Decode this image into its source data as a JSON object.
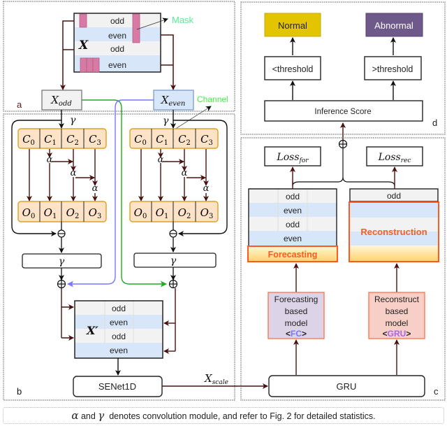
{
  "panels": {
    "a": {
      "label": "a",
      "input": {
        "symbol": "X",
        "rows": [
          "odd",
          "even",
          "odd",
          "even"
        ],
        "mask_label": "Mask"
      },
      "x_odd": "X",
      "x_odd_sub": "odd",
      "x_even": "X",
      "x_even_sub": "even",
      "channel_label": "Channel"
    },
    "b": {
      "label": "b",
      "gamma": "γ",
      "alpha": "α",
      "c_cells": [
        [
          "C",
          "0"
        ],
        [
          "C",
          "1"
        ],
        [
          "C",
          "2"
        ],
        [
          "C",
          "3"
        ]
      ],
      "o_cells": [
        [
          "O",
          "0"
        ],
        [
          "O",
          "1"
        ],
        [
          "O",
          "2"
        ],
        [
          "O",
          "3"
        ]
      ],
      "merged": {
        "symbol": "X′",
        "rows": [
          "odd",
          "even",
          "odd",
          "even"
        ]
      },
      "senet": "SENet1D",
      "x_scale": "X",
      "x_scale_sub": "scale"
    },
    "c": {
      "label": "c",
      "loss_for": "Loss",
      "loss_for_sub": "for",
      "loss_rec": "Loss",
      "loss_rec_sub": "rec",
      "forecast_rows": [
        "odd",
        "even",
        "odd",
        "even"
      ],
      "forecast_label": "Forecasting",
      "recon_top": "odd",
      "recon_label": "Reconstruction",
      "fc_model": [
        "Forecasting",
        "based",
        "model"
      ],
      "fc_tag_open": "<",
      "fc_tag": "FC",
      "fc_tag_close": ">",
      "gru_model": [
        "Reconstruct",
        "based",
        "model"
      ],
      "gru_tag_open": "<",
      "gru_tag": "GRU",
      "gru_tag_close": ">",
      "gru": "GRU"
    },
    "d": {
      "label": "d",
      "normal": "Normal",
      "abnormal": "Abnormal",
      "lt_threshold": "<threshold",
      "gt_threshold": ">threshold",
      "inference": "Inference Score"
    }
  },
  "caption": {
    "alpha": "α",
    "and": " and ",
    "gamma": "γ",
    "text": "  denotes convolution module, and refer to Fig. 2 for detailed statistics."
  },
  "colors": {
    "arrow_dark": "#4a1010",
    "normal_fill": "#e3c400",
    "abnormal_fill": "#6e5a8a",
    "cell_orange": "#fce3c8",
    "cell_orange_border": "#e0a020",
    "blue_row": "#d7e6f8",
    "grey_row": "#f2f2f2",
    "mask_pink": "#d77ba4",
    "green_line": "#22aa22",
    "blue_line": "#7777ff",
    "accent_orange": "#ff5a1f",
    "fc_fill": "#ddd3e6",
    "gru_fill": "#f8cfc6"
  }
}
